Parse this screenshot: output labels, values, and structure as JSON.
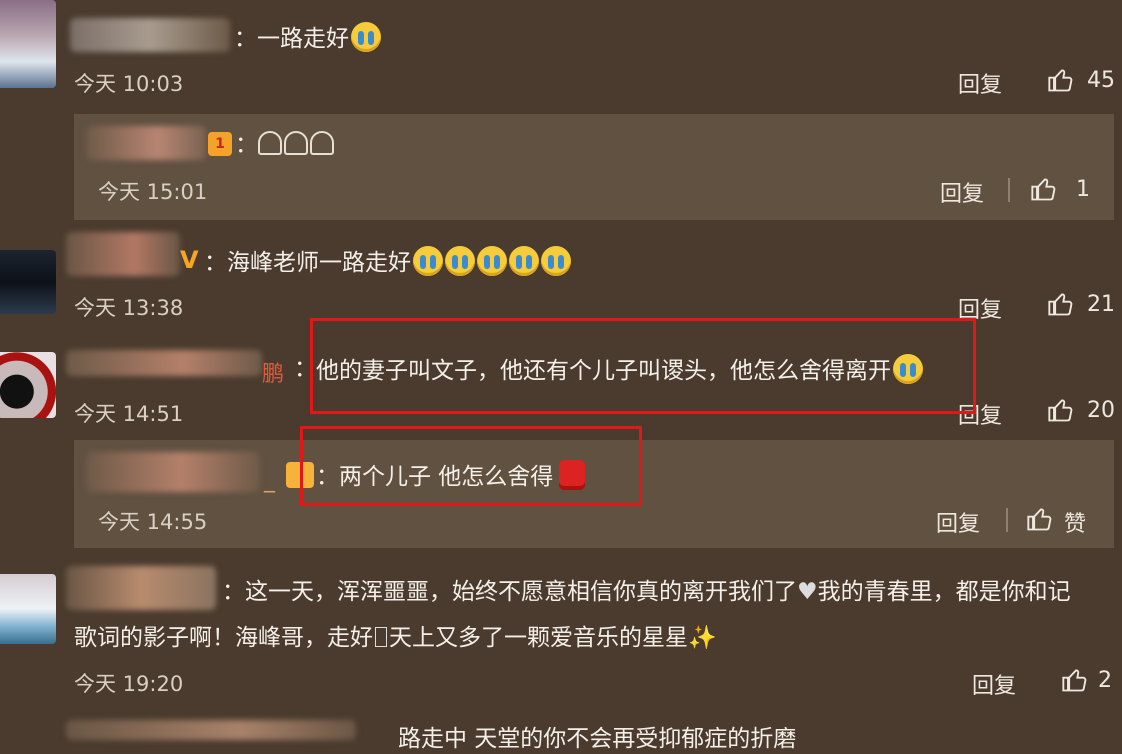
{
  "comments": [
    {
      "text": "：一路走好",
      "time": "今天 10:03",
      "reply": "回复",
      "likes": "45"
    },
    {
      "text": "：海峰老师一路走好",
      "time": "今天 13:38",
      "reply": "回复",
      "likes": "21"
    },
    {
      "text": "他的妻子叫文子，他还有个儿子叫谡头，他怎么舍得离开",
      "user_suffix": "鹏",
      "time": "今天 14:51",
      "reply": "回复",
      "likes": "20"
    },
    {
      "text_line1": "：这一天，浑浑噩噩，始终不愿意相信你真的离开我们了",
      "text_line1b": "我的青春里，都是你和记",
      "text_line2": "歌词的影子啊！海峰哥，走好",
      "text_line2b": "天上又多了一颗爱音乐的星星",
      "time": "今天 19:20",
      "reply": "回复",
      "likes": "2"
    },
    {
      "text": "路走中   天堂的你不会再受抑郁症的折磨"
    }
  ],
  "subreplies": [
    {
      "text": "：",
      "time": "今天 15:01",
      "reply": "回复",
      "likes": "1"
    },
    {
      "text": "：两个儿子 他怎么舍得",
      "user_suffix": "_",
      "time": "今天 14:55",
      "reply": "回复",
      "likes": "赞"
    }
  ],
  "icons": {
    "like": "thumb-up-icon",
    "cry": "crying-face-emoji",
    "candle": "candle-emoji",
    "verified": "v-badge-icon"
  },
  "colors": {
    "background": "#4a3b2e",
    "subreply_bg": "#615141",
    "highlight": "#e01818",
    "text": "#f4efe8"
  }
}
